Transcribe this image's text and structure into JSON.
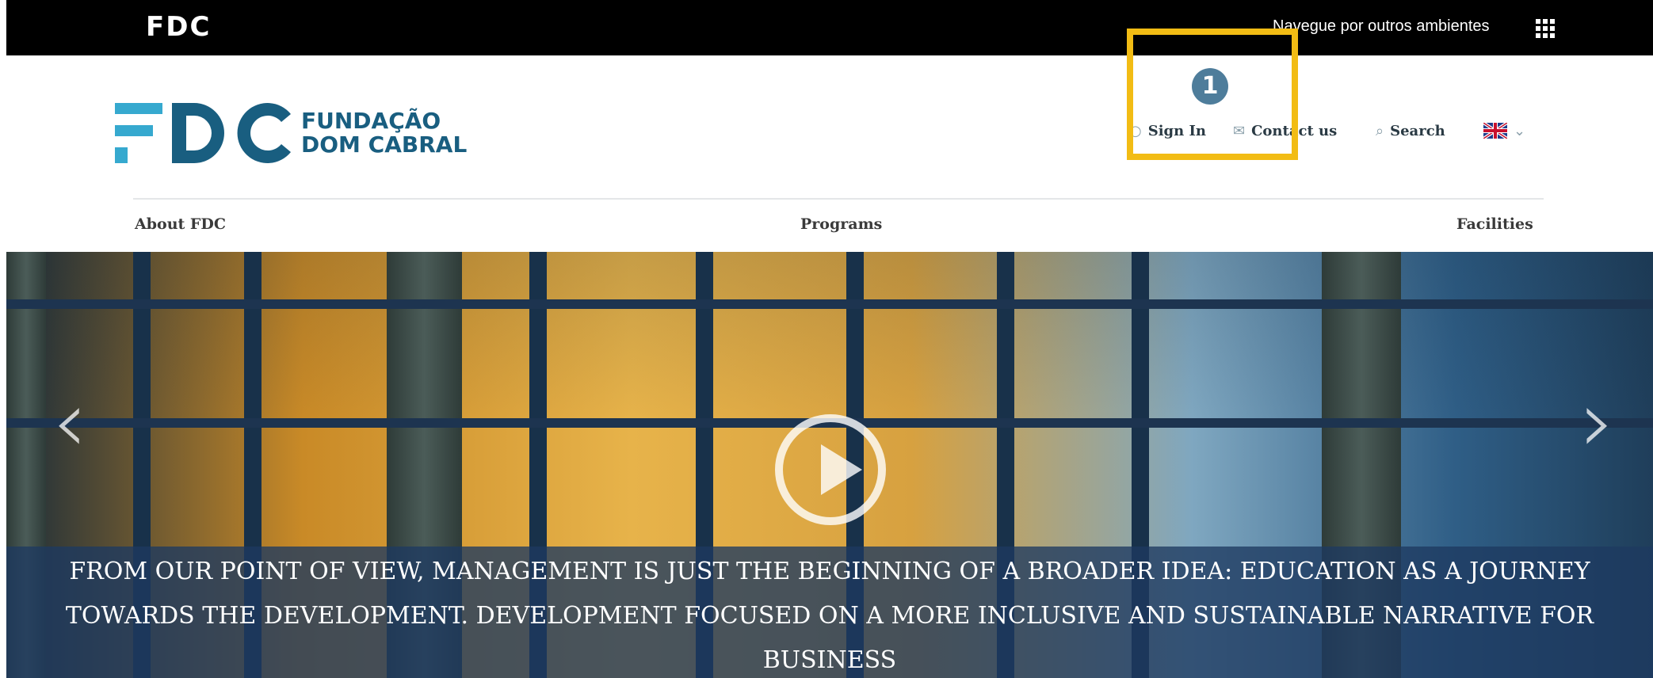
{
  "topbar": {
    "mini_logo": "FDC",
    "environments_label": "Navegue por outros ambientes",
    "apps_icon": "grid-dots-icon"
  },
  "header": {
    "logo_mark": "FDC",
    "logo_text_line1": "FUNDAÇÃO",
    "logo_text_line2": "DOM CABRAL",
    "sign_in": "Sign In",
    "contact_us": "Contact us",
    "search": "Search",
    "language_flag": "uk-flag-icon"
  },
  "annotation": {
    "step": "1",
    "highlight_color": "#f2bc14"
  },
  "nav": {
    "items": [
      "About FDC",
      "Programs",
      "Facilities"
    ]
  },
  "hero": {
    "caption": "FROM OUR POINT OF VIEW, MANAGEMENT IS JUST THE BEGINNING OF A BROADER IDEA: EDUCATION AS A JOURNEY TOWARDS THE DEVELOPMENT. DEVELOPMENT FOCUSED ON A MORE INCLUSIVE AND SUSTAINABLE NARRATIVE FOR BUSINESS",
    "prev_icon": "chevron-left-icon",
    "next_icon": "chevron-right-icon",
    "play_icon": "play-icon"
  },
  "colors": {
    "brand_dark": "#195e80",
    "brand_light": "#36a9cf",
    "topbar": "#000000"
  }
}
